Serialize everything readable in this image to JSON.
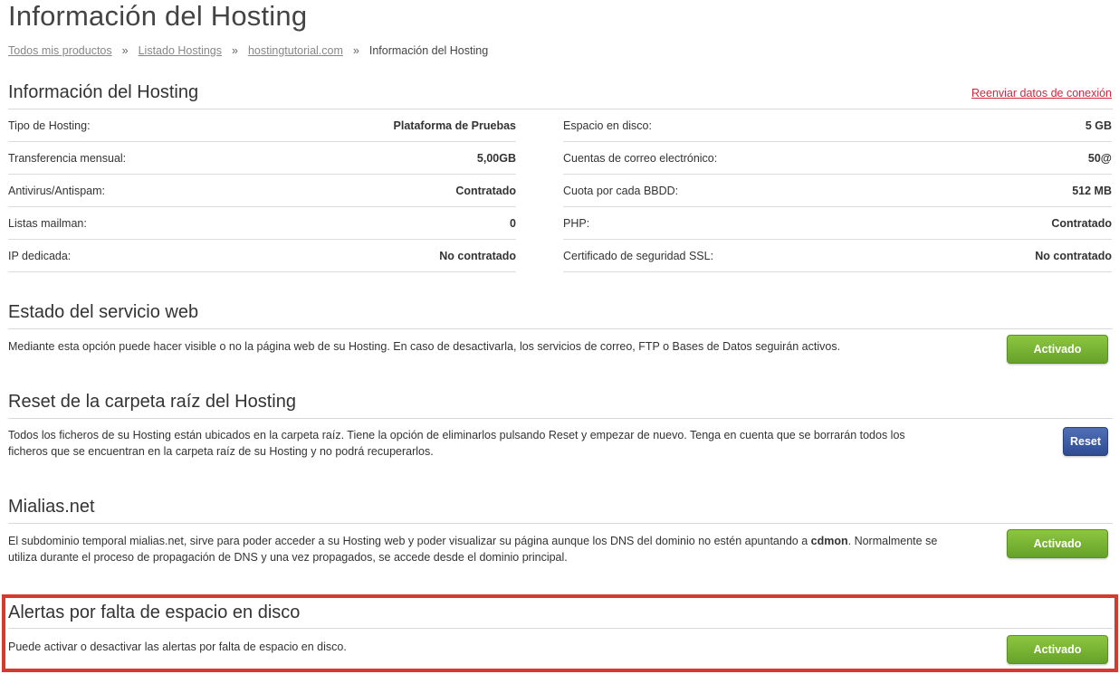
{
  "page_title": "Información del Hosting",
  "breadcrumb": {
    "items": [
      "Todos mis productos",
      "Listado Hostings",
      "hostingtutorial.com"
    ],
    "separator": "»",
    "current": "Información del Hosting"
  },
  "hosting_info": {
    "title": "Información del Hosting",
    "resend_link": "Reenviar datos de conexión",
    "left": [
      {
        "label": "Tipo de Hosting:",
        "value": "Plataforma de Pruebas"
      },
      {
        "label": "Transferencia mensual:",
        "value": "5,00GB"
      },
      {
        "label": "Antivirus/Antispam:",
        "value": "Contratado"
      },
      {
        "label": "Listas mailman:",
        "value": "0"
      },
      {
        "label": "IP dedicada:",
        "value": "No contratado"
      }
    ],
    "right": [
      {
        "label": "Espacio en disco:",
        "value": "5 GB"
      },
      {
        "label": "Cuentas de correo electrónico:",
        "value": "50@"
      },
      {
        "label": "Cuota por cada BBDD:",
        "value": "512 MB"
      },
      {
        "label": "PHP:",
        "value": "Contratado"
      },
      {
        "label": "Certificado de seguridad SSL:",
        "value": "No contratado"
      }
    ]
  },
  "web_service": {
    "title": "Estado del servicio web",
    "text": "Mediante esta opción puede hacer visible o no la página web de su Hosting. En caso de desactivarla, los servicios de correo, FTP o Bases de Datos seguirán activos.",
    "button": "Activado"
  },
  "reset_root": {
    "title": "Reset de la carpeta raíz del Hosting",
    "text_line1": "Todos los ficheros de su Hosting están ubicados en la carpeta raíz. Tiene la opción de eliminarlos pulsando Reset y empezar de nuevo. Tenga en cuenta que se borrarán todos los",
    "text_line2": "ficheros que se encuentran en la carpeta raíz de su Hosting y no podrá recuperarlos.",
    "button": "Reset"
  },
  "mialias": {
    "title": "Mialias.net",
    "text_line1_pre": "El subdominio temporal mialias.net, sirve para poder acceder a su Hosting web y poder visualizar su página aunque los DNS del dominio no estén apuntando a ",
    "text_line1_bold": "cdmon",
    "text_line1_post": ". Normalmente se",
    "text_line2": "utiliza durante el proceso de propagación de DNS y una vez propagados, se accede desde el dominio principal.",
    "button": "Activado"
  },
  "disk_alerts": {
    "title": "Alertas por falta de espacio en disco",
    "text": "Puede activar o desactivar las alertas por falta de espacio en disco.",
    "button": "Activado"
  },
  "colors": {
    "green_button": "#66a22a",
    "blue_button": "#2f4c93",
    "link_red": "#d0273e",
    "highlight_border": "#d63a2f"
  }
}
